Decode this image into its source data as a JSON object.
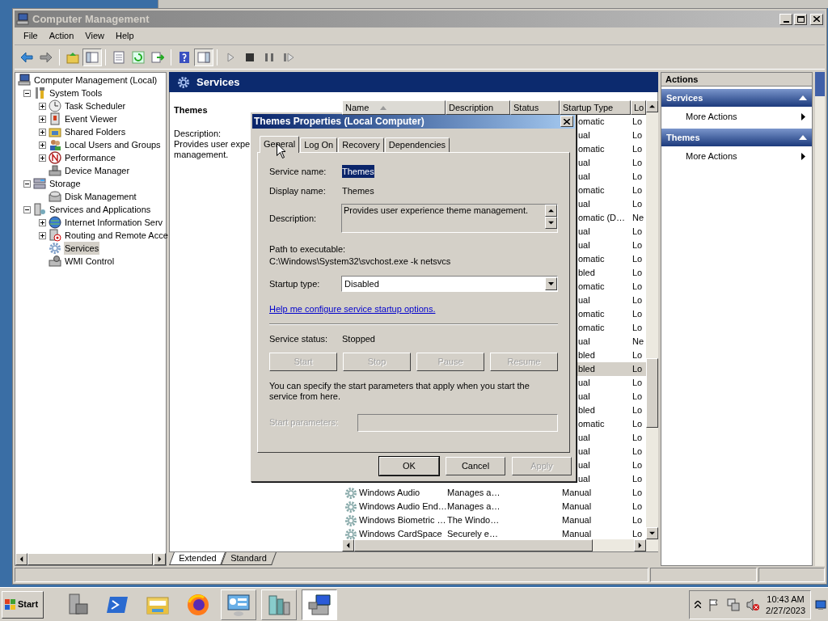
{
  "window": {
    "title": "Computer Management"
  },
  "menu": [
    "File",
    "Action",
    "View",
    "Help"
  ],
  "toolbar_groups": [
    [
      {
        "pressed": false
      },
      {
        "pressed": false
      }
    ],
    [
      {
        "pressed": false
      },
      {
        "pressed": true
      }
    ],
    [
      {
        "pressed": false
      },
      {
        "pressed": false
      },
      {
        "pressed": false
      }
    ],
    [
      {
        "pressed": false
      },
      {
        "pressed": true
      }
    ],
    [
      {
        "pressed": false
      },
      {
        "pressed": false
      },
      {
        "pressed": false
      },
      {
        "pressed": false
      }
    ]
  ],
  "tree": [
    {
      "label": "Computer Management (Local)",
      "expandable": false,
      "selected": false,
      "children": [
        {
          "label": "System Tools",
          "expandable": true,
          "expanded": true,
          "selected": false,
          "children": [
            {
              "label": "Task Scheduler",
              "expandable": true,
              "expanded": false,
              "selected": false
            },
            {
              "label": "Event Viewer",
              "expandable": true,
              "expanded": false,
              "selected": false
            },
            {
              "label": "Shared Folders",
              "expandable": true,
              "expanded": false,
              "selected": false
            },
            {
              "label": "Local Users and Groups",
              "expandable": true,
              "expanded": false,
              "selected": false
            },
            {
              "label": "Performance",
              "expandable": true,
              "expanded": false,
              "selected": false
            },
            {
              "label": "Device Manager",
              "expandable": false,
              "selected": false
            }
          ]
        },
        {
          "label": "Storage",
          "expandable": true,
          "expanded": true,
          "selected": false,
          "children": [
            {
              "label": "Disk Management",
              "expandable": false,
              "selected": false
            }
          ]
        },
        {
          "label": "Services and Applications",
          "expandable": true,
          "expanded": true,
          "selected": false,
          "children": [
            {
              "label": "Internet Information Serv",
              "expandable": true,
              "expanded": false,
              "selected": false
            },
            {
              "label": "Routing and Remote Acce",
              "expandable": true,
              "expanded": false,
              "selected": false
            },
            {
              "label": "Services",
              "expandable": false,
              "selected": true
            },
            {
              "label": "WMI Control",
              "expandable": false,
              "selected": false
            }
          ]
        }
      ]
    }
  ],
  "center": {
    "title": "Services",
    "service_name": "Themes",
    "description_label": "Description:",
    "description_lines": [
      "Provides user expe",
      "management."
    ],
    "columns": [
      {
        "label": "Name",
        "sorted": true
      },
      {
        "label": "Description",
        "sorted": false
      },
      {
        "label": "Status",
        "sorted": false
      },
      {
        "label": "Startup Type",
        "sorted": false
      },
      {
        "label": "Lo",
        "sorted": false
      }
    ],
    "rows": [
      {
        "startup": "omatic",
        "log_on": "Lo",
        "selected": false
      },
      {
        "startup": "ual",
        "log_on": "Lo",
        "selected": false
      },
      {
        "startup": "omatic",
        "log_on": "Lo",
        "selected": false
      },
      {
        "startup": "ual",
        "log_on": "Lo",
        "selected": false
      },
      {
        "startup": "ual",
        "log_on": "Lo",
        "selected": false
      },
      {
        "startup": "omatic",
        "log_on": "Lo",
        "selected": false
      },
      {
        "startup": "ual",
        "log_on": "Lo",
        "selected": false
      },
      {
        "startup": "omatic (D…",
        "log_on": "Ne",
        "selected": false
      },
      {
        "startup": "ual",
        "log_on": "Lo",
        "selected": false
      },
      {
        "startup": "ual",
        "log_on": "Lo",
        "selected": false
      },
      {
        "startup": "omatic",
        "log_on": "Lo",
        "selected": false
      },
      {
        "startup": "bled",
        "log_on": "Lo",
        "selected": false
      },
      {
        "startup": "omatic",
        "log_on": "Lo",
        "selected": false
      },
      {
        "startup": "ual",
        "log_on": "Lo",
        "selected": false
      },
      {
        "startup": "omatic",
        "log_on": "Lo",
        "selected": false
      },
      {
        "startup": "omatic",
        "log_on": "Lo",
        "selected": false
      },
      {
        "startup": "ual",
        "log_on": "Ne",
        "selected": false
      },
      {
        "startup": "bled",
        "log_on": "Lo",
        "selected": false
      },
      {
        "startup": "bled",
        "log_on": "Lo",
        "selected": true
      },
      {
        "startup": "ual",
        "log_on": "Lo",
        "selected": false
      },
      {
        "startup": "ual",
        "log_on": "Lo",
        "selected": false
      },
      {
        "startup": "bled",
        "log_on": "Lo",
        "selected": false
      },
      {
        "startup": "omatic",
        "log_on": "Lo",
        "selected": false
      },
      {
        "startup": "ual",
        "log_on": "Lo",
        "selected": false
      },
      {
        "startup": "ual",
        "log_on": "Lo",
        "selected": false
      },
      {
        "startup": "ual",
        "log_on": "Lo",
        "selected": false
      },
      {
        "startup": "ual",
        "log_on": "Lo",
        "selected": false
      },
      {
        "name": "Windows Audio",
        "description": "Manages a…",
        "startup": "Manual",
        "log_on": "Lo",
        "selected": false
      },
      {
        "name": "Windows Audio End…",
        "description": "Manages a…",
        "startup": "Manual",
        "log_on": "Lo",
        "selected": false
      },
      {
        "name": "Windows Biometric …",
        "description": "The Windo…",
        "startup": "Manual",
        "log_on": "Lo",
        "selected": false
      },
      {
        "name": "Windows CardSpace",
        "description": "Securely e…",
        "startup": "Manual",
        "log_on": "Lo",
        "selected": false
      }
    ],
    "view_tabs": [
      {
        "label": "Extended",
        "selected": true
      },
      {
        "label": "Standard",
        "selected": false
      }
    ]
  },
  "actions": {
    "title": "Actions",
    "sections": [
      {
        "title": "Services",
        "items": [
          "More Actions"
        ]
      },
      {
        "title": "Themes",
        "items": [
          "More Actions"
        ]
      }
    ]
  },
  "dialog": {
    "title": "Themes Properties (Local Computer)",
    "tabs": [
      {
        "label": "General",
        "selected": true
      },
      {
        "label": "Log On",
        "selected": false
      },
      {
        "label": "Recovery",
        "selected": false
      },
      {
        "label": "Dependencies",
        "selected": false
      }
    ],
    "service_name_label": "Service name:",
    "service_name": "Themes",
    "service_name_highlighted": true,
    "display_name_label": "Display name:",
    "display_name": "Themes",
    "description_label": "Description:",
    "description": "Provides user experience theme management.",
    "path_label": "Path to executable:",
    "path": "C:\\Windows\\System32\\svchost.exe -k netsvcs",
    "startup_type_label": "Startup type:",
    "startup_type": "Disabled",
    "help_link": "Help me configure service startup options.",
    "status_label": "Service status:",
    "status": "Stopped",
    "service_buttons": [
      {
        "label": "Start",
        "disabled": true
      },
      {
        "label": "Stop",
        "disabled": true
      },
      {
        "label": "Pause",
        "disabled": true
      },
      {
        "label": "Resume",
        "disabled": true
      }
    ],
    "params_note": "You can specify the start parameters that apply when you start the service from here.",
    "params_label": "Start parameters:",
    "params_disabled": true,
    "buttons": [
      {
        "label": "OK",
        "disabled": false,
        "default": true
      },
      {
        "label": "Cancel",
        "disabled": false,
        "default": false
      },
      {
        "label": "Apply",
        "disabled": true,
        "default": false
      }
    ]
  },
  "taskbar": {
    "start": "Start",
    "apps": [
      {
        "running": false,
        "selected": false
      },
      {
        "running": false,
        "selected": false
      },
      {
        "running": false,
        "selected": false
      },
      {
        "running": false,
        "selected": false
      },
      {
        "running": true,
        "selected": false
      },
      {
        "running": true,
        "selected": false
      },
      {
        "running": true,
        "selected": true
      }
    ],
    "time": "10:43 AM",
    "date": "2/27/2023"
  }
}
